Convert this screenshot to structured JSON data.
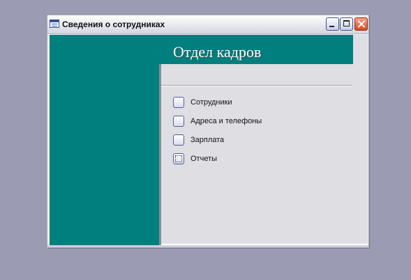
{
  "window": {
    "title": "Сведения о сотрудниках"
  },
  "form": {
    "heading": "Отдел кадров",
    "menu": [
      {
        "label": "Сотрудники",
        "focused": false
      },
      {
        "label": "Адреса и телефоны",
        "focused": false
      },
      {
        "label": "Зарплата",
        "focused": false
      },
      {
        "label": "Отчеты",
        "focused": true
      }
    ]
  },
  "colors": {
    "desktop": "#9c9bb4",
    "header_band": "#007f7f",
    "client_background": "#dfdee3",
    "close_button": "#d84a22"
  },
  "icons": {
    "window": "form-window-icon",
    "minimize": "minimize-icon",
    "maximize": "maximize-icon",
    "close": "close-icon"
  }
}
